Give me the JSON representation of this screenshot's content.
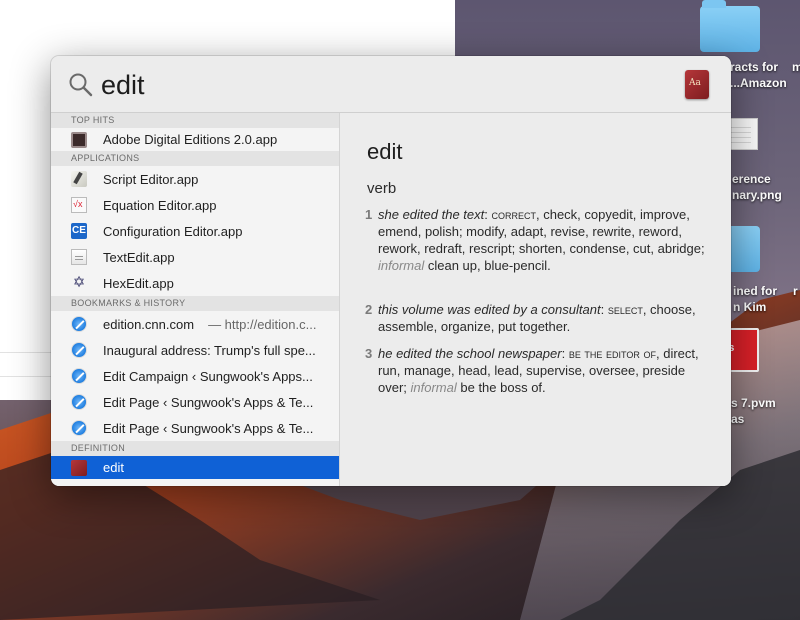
{
  "search": {
    "query": "edit"
  },
  "results": {
    "sections": {
      "top_hits": "TOP HITS",
      "applications": "APPLICATIONS",
      "bookmarks": "BOOKMARKS & HISTORY",
      "definition": "DEFINITION"
    },
    "top_hits": [
      {
        "label": "Adobe Digital Editions 2.0.app",
        "icon": "adobe-digital-editions-icon"
      }
    ],
    "applications": [
      {
        "label": "Script Editor.app",
        "icon": "script-editor-icon"
      },
      {
        "label": "Equation Editor.app",
        "icon": "equation-editor-icon"
      },
      {
        "label": "Configuration Editor.app",
        "icon": "configuration-editor-icon"
      },
      {
        "label": "TextEdit.app",
        "icon": "textedit-icon"
      },
      {
        "label": "HexEdit.app",
        "icon": "hexedit-icon"
      }
    ],
    "bookmarks": [
      {
        "label": "edition.cnn.com",
        "sub": "— http://edition.c...",
        "icon": "safari-icon"
      },
      {
        "label": "Inaugural address: Trump's full spe...",
        "icon": "safari-icon"
      },
      {
        "label": "Edit Campaign ‹ Sungwook's Apps...",
        "icon": "safari-icon"
      },
      {
        "label": "Edit Page ‹ Sungwook's Apps & Te...",
        "icon": "safari-icon"
      },
      {
        "label": "Edit Page ‹ Sungwook's Apps & Te...",
        "icon": "safari-icon"
      }
    ],
    "definition": [
      {
        "label": "edit",
        "icon": "dictionary-icon",
        "selected": true
      }
    ]
  },
  "preview": {
    "word": "edit",
    "part_of_speech": "verb",
    "senses": [
      {
        "num": "1",
        "example": "she edited the text",
        "head": "correct",
        "synonyms_a": ", check, copyedit, improve, emend, polish; modify, adapt, revise, rewrite, reword, rework, redraft, rescript; shorten, condense, cut, abridge; ",
        "register": "informal",
        "synonyms_b": " clean up, blue-pencil."
      },
      {
        "num": "2",
        "example": "this volume was edited by a consultant",
        "head": "select",
        "synonyms_a": ", choose, assemble, organize, put together."
      },
      {
        "num": "3",
        "example": "he edited the school newspaper",
        "head": "be the editor of",
        "synonyms_a": ", direct, run, manage, head, lead, supervise, oversee, preside over; ",
        "register": "informal",
        "synonyms_b": " be the boss of."
      }
    ]
  },
  "desktop": {
    "items": [
      {
        "label_1": "racts for",
        "label_2": "...Amazon",
        "extra": "m"
      },
      {
        "label_1": "erence",
        "label_2": "nary.png"
      },
      {
        "label_1": "ined for",
        "label_2": "n Kim",
        "extra": "r"
      },
      {
        "label_1": "s 7.pvm",
        "label_2": "as",
        "badge": "llels"
      }
    ]
  }
}
